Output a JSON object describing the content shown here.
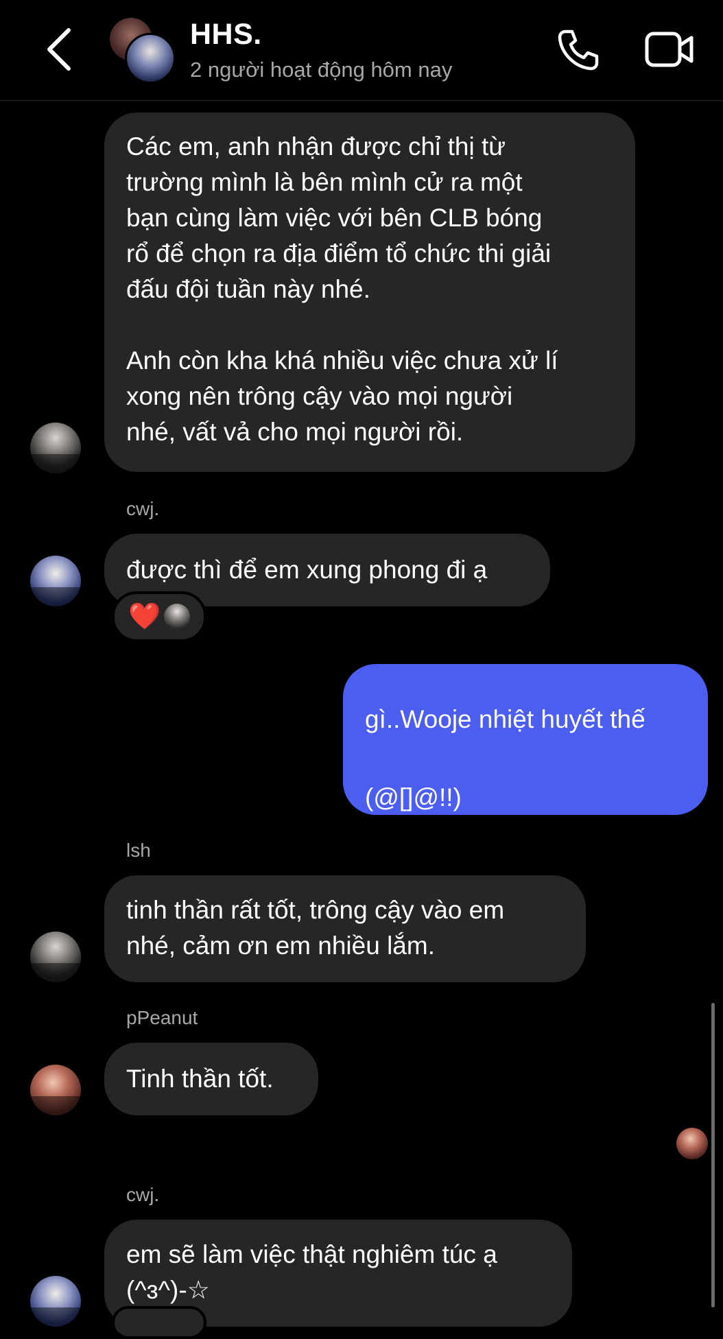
{
  "header": {
    "title": "HHS.",
    "status": "2 người hoạt động hôm nay",
    "back_icon": "chevron-left-icon",
    "call_icon": "phone-icon",
    "video_icon": "video-camera-icon"
  },
  "messages": [
    {
      "sender": "",
      "text": "Các em, anh nhận được chỉ thị từ\ntrường mình là bên mình cử ra một\nbạn cùng làm việc với bên CLB bóng\nrổ để chọn ra địa điểm tổ chức thi giải\nđấu đội tuần này nhé.\n\nAnh còn kha khá nhiều việc chưa xử lí\nxong nên trông cậy vào mọi người\nnhé, vất vả cho mọi người rồi."
    },
    {
      "sender": "cwj.",
      "text": "được thì để em xung phong đi ạ",
      "reaction": "❤️"
    },
    {
      "sender": "",
      "outgoing": true,
      "text": "gì..Wooje nhiệt huyết thế\n\n(@[]@!!)"
    },
    {
      "sender": "lsh",
      "text": "tinh thần rất tốt, trông cậy vào em\nnhé, cảm ơn em nhiều lắm."
    },
    {
      "sender": "pPeanut",
      "text": "Tinh thần tốt."
    },
    {
      "sender": "cwj.",
      "text": "em sẽ làm việc thật nghiêm túc ạ\n(^ɜ^)-☆"
    }
  ],
  "colors": {
    "background": "#000000",
    "incoming_bubble": "#262626",
    "outgoing_bubble": "#4c5ef0",
    "secondary_text": "#a8a8a8"
  }
}
